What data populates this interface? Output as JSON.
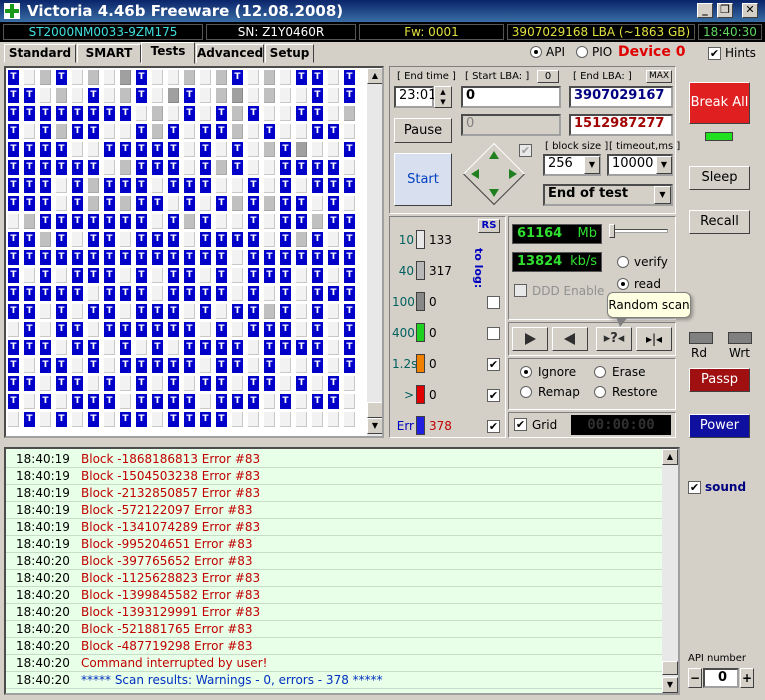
{
  "window": {
    "title": "Victoria 4.46b Freeware (12.08.2008)",
    "btn_min": "_",
    "btn_max": "❐",
    "btn_close": "✕"
  },
  "infobar": {
    "model": "ST2000NM0033-9ZM175",
    "serial": "SN: Z1Y0460R",
    "firmware": "Fw: 0001",
    "lba": "3907029168 LBA (~1863 GB)",
    "clock": "18:40:30"
  },
  "tabs": [
    "Standard",
    "SMART",
    "Tests",
    "Advanced",
    "Setup"
  ],
  "mode": {
    "api": "API",
    "pio": "PIO",
    "device": "Device 0",
    "hints": "Hints"
  },
  "controls": {
    "end_time_label": "[ End time ]",
    "end_time": "23:01",
    "start_lba_label": "[ Start LBA: ]",
    "start_lba_btn": "0",
    "start_lba": "0",
    "end_lba_label": "[ End LBA: ]",
    "end_lba_btn": "MAX",
    "end_lba": "3907029167",
    "pause": "Pause",
    "current_lba": "0",
    "current_lba_red": "1512987277",
    "start": "Start",
    "block_size_label": "[ block size ]",
    "block_size": "256",
    "timeout_label": "[ timeout,ms ]",
    "timeout": "10000",
    "end_action": "End of test"
  },
  "sidebar": {
    "break_all": "Break All",
    "sleep": "Sleep",
    "recall": "Recall",
    "rd": "Rd",
    "wrt": "Wrt",
    "passp": "Passp",
    "power": "Power",
    "sound": "sound",
    "api_number_label": "API number",
    "api_minus": "−",
    "api_value": "0",
    "api_plus": "+"
  },
  "legend": {
    "rs": "RS",
    "to_log": "to log:",
    "rows": [
      {
        "label": "10",
        "count": "133",
        "color": "#e8e8e8"
      },
      {
        "label": "40",
        "count": "317",
        "color": "#b8b8b8"
      },
      {
        "label": "100",
        "count": "0",
        "color": "#888888"
      },
      {
        "label": "400",
        "count": "0",
        "color": "#20d020"
      },
      {
        "label": "1.2s",
        "count": "0",
        "color": "#f08000"
      },
      {
        "label": ">",
        "count": "0",
        "color": "#e00000"
      },
      {
        "label": "Err",
        "count": "378",
        "color": "#2020e0"
      }
    ]
  },
  "stats": {
    "position": "61164",
    "position_unit": "Mb",
    "speed": "13824",
    "speed_unit": "kb/s",
    "verify": "verify",
    "read": "read",
    "ddd": "DDD Enable",
    "tooltip": "Random scan"
  },
  "actions": {
    "ignore": "Ignore",
    "erase": "Erase",
    "remap": "Remap",
    "restore": "Restore",
    "grid": "Grid",
    "timer": "00:00:00"
  },
  "log": [
    {
      "time": "18:40:19",
      "msg": "Block -1868186813 Error #83",
      "color": "#c00000"
    },
    {
      "time": "18:40:19",
      "msg": "Block -1504503238 Error #83",
      "color": "#c00000"
    },
    {
      "time": "18:40:19",
      "msg": "Block -2132850857 Error #83",
      "color": "#c00000"
    },
    {
      "time": "18:40:19",
      "msg": "Block -572122097 Error #83",
      "color": "#c00000"
    },
    {
      "time": "18:40:19",
      "msg": "Block -1341074289 Error #83",
      "color": "#c00000"
    },
    {
      "time": "18:40:19",
      "msg": "Block -995204651 Error #83",
      "color": "#c00000"
    },
    {
      "time": "18:40:20",
      "msg": "Block -397765652 Error #83",
      "color": "#c00000"
    },
    {
      "time": "18:40:20",
      "msg": "Block -1125628823 Error #83",
      "color": "#c00000"
    },
    {
      "time": "18:40:20",
      "msg": "Block -1399845582 Error #83",
      "color": "#c00000"
    },
    {
      "time": "18:40:20",
      "msg": "Block -1393129991 Error #83",
      "color": "#c00000"
    },
    {
      "time": "18:40:20",
      "msg": "Block -521881765 Error #83",
      "color": "#c00000"
    },
    {
      "time": "18:40:20",
      "msg": "Block -487719298 Error #83",
      "color": "#c00000"
    },
    {
      "time": "18:40:20",
      "msg": "Command interrupted by user!",
      "color": "#c00000"
    },
    {
      "time": "18:40:20",
      "msg": "***** Scan results: Warnings - 0, errors - 378 *****",
      "color": "#0030c0"
    }
  ],
  "grid_rows": [
    "T01T0102T00101T010TT0T",
    "TT010T01T02T0120100T0T",
    "TTTTTTTT010T0T1T00TT01",
    "T0T1TT00T1T0TT10T00TT0",
    "TTTT00TTTTT0T0T01T200T",
    "TTTTTT01TTT0T1T00TTTT0",
    "TTT0T1TTT0TTT00T0T0TTT",
    "TTT0T1T1TT0T0T1T1TT0T0",
    "01TTTTTTT0T1T00T0TT1TT",
    "TT1T0TT0TTT0TTTT0T1T0T",
    "TTTTTTTTTTTTTT0TTTTTTT",
    "T0T0TTT0T0TT0T0TTT0T0T",
    "TTTTT0TTT0TTTT0T0T0TTT",
    "TT0T0TT0TTT0T0TT1T0T0T",
    "0T0TT0TTTTTT0T0TTT0T0T",
    "TTT0TT0T0T0TTTT0TTTT0T",
    "T0TT0T0TTTTT0TT0T00T0T",
    "TT0TT0T0T0T0TT0TT0T0T0",
    "T0T0TTT0TTTT0TTT0T0TT0",
    "0T0T0T0TT0TTTT00000000"
  ]
}
